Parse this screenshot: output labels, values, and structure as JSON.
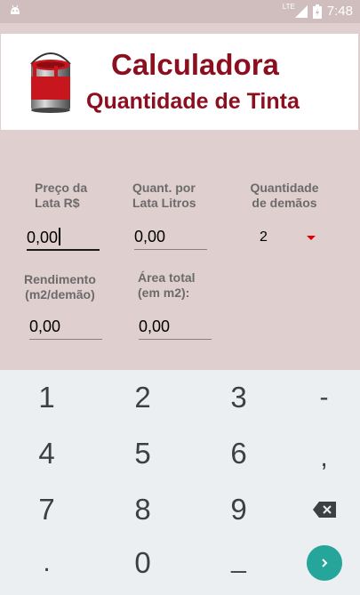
{
  "status_bar": {
    "time": "7:48",
    "network_label": "LTE"
  },
  "header": {
    "title": "Calculadora",
    "subtitle": "Quantidade de Tinta",
    "icon": "paint-bucket-icon"
  },
  "form": {
    "preco": {
      "label_line1": "Preço da",
      "label_line2": "Lata R$",
      "value": "0,00"
    },
    "quant": {
      "label_line1": "Quant. por",
      "label_line2": "Lata Litros",
      "value": "0,00"
    },
    "demaos": {
      "label_line1": "Quantidade",
      "label_line2": "de demãos",
      "selected": "2"
    },
    "rendimento": {
      "label_line1": "Rendimento",
      "label_line2": "(m2/demão)",
      "value": "0,00"
    },
    "area": {
      "label_line1": "Área total",
      "label_line2": "(em m2):",
      "value": "0,00"
    }
  },
  "keyboard": {
    "rows": [
      [
        "1",
        "2",
        "3",
        "-"
      ],
      [
        "4",
        "5",
        "6",
        ","
      ],
      [
        "7",
        "8",
        "9",
        "backspace-icon"
      ],
      [
        ".",
        "0",
        "_",
        "go-icon"
      ]
    ],
    "accent_color": "#26a69a"
  },
  "colors": {
    "title": "#8b0f1f",
    "background": "#e0cfcf",
    "spinner_arrow": "#e00000"
  }
}
